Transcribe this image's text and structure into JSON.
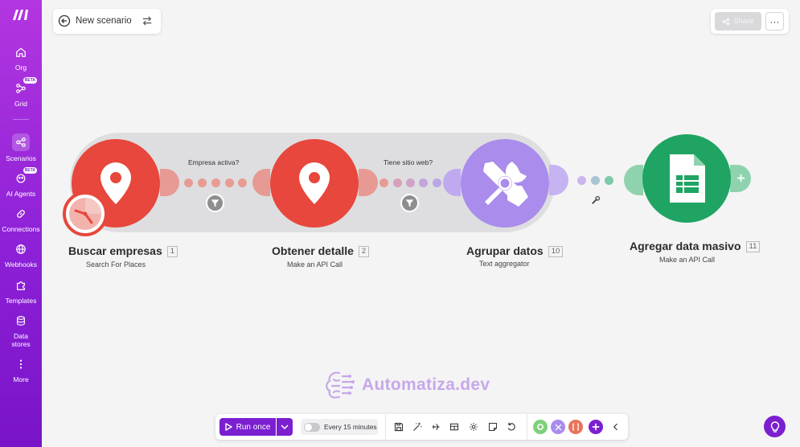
{
  "sidebar": {
    "items": [
      {
        "label": "Org",
        "icon": "home-icon"
      },
      {
        "label": "Grid",
        "icon": "grid-icon",
        "badge": "BETA"
      },
      {
        "label": "Scenarios",
        "icon": "share-nodes-icon"
      },
      {
        "label": "AI Agents",
        "icon": "ai-agent-icon",
        "badge": "BETA"
      },
      {
        "label": "Connections",
        "icon": "link-icon"
      },
      {
        "label": "Webhooks",
        "icon": "globe-icon"
      },
      {
        "label": "Templates",
        "icon": "puzzle-icon"
      },
      {
        "label": "Data stores",
        "icon": "database-icon"
      },
      {
        "label": "More",
        "icon": "vertical-dots-icon"
      }
    ]
  },
  "header": {
    "scenario_name": "New scenario",
    "share_label": "Share",
    "more_label": "···"
  },
  "flow": {
    "modules": [
      {
        "title": "Buscar empresas",
        "number": "1",
        "subtitle": "Search For Places",
        "icon": "map-pin-icon",
        "color": "#e7473c"
      },
      {
        "title": "Obtener detalle",
        "number": "2",
        "subtitle": "Make an API Call",
        "icon": "map-pin-icon",
        "color": "#e7473c"
      },
      {
        "title": "Agrupar datos",
        "number": "10",
        "subtitle": "Text aggregator",
        "icon": "tools-icon",
        "color": "#a98cec"
      },
      {
        "title": "Agregar data masivo",
        "number": "11",
        "subtitle": "Make an API Call",
        "icon": "spreadsheet-icon",
        "color": "#1fa463"
      }
    ],
    "routes": [
      {
        "label": "Empresa activa?"
      },
      {
        "label": "Tiene sitio web?"
      }
    ]
  },
  "watermark": {
    "text": "Automatiza.dev"
  },
  "toolbar": {
    "run_label": "Run once",
    "schedule_label": "Every 15 minutes"
  },
  "colors": {
    "brand": "#7b1fd0",
    "maps_red": "#e7473c",
    "tools_purple": "#a98cec",
    "sheets_green": "#1fa463"
  }
}
